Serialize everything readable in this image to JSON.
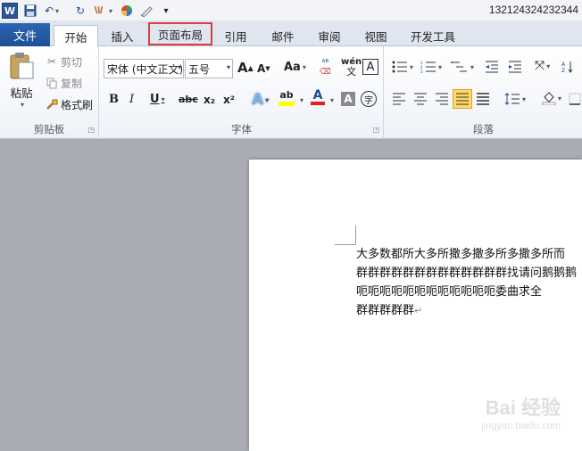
{
  "titlebar": {
    "app_icon": "W",
    "doc_title": "132124324232344",
    "icons": [
      "word-logo-icon",
      "save-icon",
      "undo-icon",
      "redo-icon",
      "format-painter-icon",
      "color-icon",
      "pen-icon",
      "customize-icon"
    ]
  },
  "tabs": {
    "file": "文件",
    "items": [
      "开始",
      "插入",
      "页面布局",
      "引用",
      "邮件",
      "审阅",
      "视图",
      "开发工具"
    ],
    "active": "开始",
    "highlighted": "页面布局"
  },
  "ribbon": {
    "clipboard": {
      "label": "剪贴板",
      "paste": "粘贴",
      "cut": "剪切",
      "copy": "复制",
      "format_painter": "格式刷"
    },
    "font": {
      "label": "字体",
      "font_name": "宋体 (中文正文)",
      "font_size": "五号",
      "grow": "A",
      "shrink": "A",
      "change_case": "Aa",
      "phonetic": "wén",
      "border_char": "A",
      "bold": "B",
      "italic": "I",
      "underline": "U",
      "strike": "abc",
      "subscript": "x₂",
      "superscript": "x²",
      "text_effect": "A",
      "highlight": "ab",
      "font_color": "A",
      "char_shading": "A",
      "enclose": "字"
    },
    "paragraph": {
      "label": "段落"
    }
  },
  "document": {
    "lines": [
      "大多数都所大多所撒多撒多所多撒多所而",
      "群群群群群群群群群群群群群找请问鹅鹅鹅",
      "呃呃呃呃呃呃呃呃呃呃呃呃委曲求全",
      "群群群群群"
    ],
    "para_mark": "↵"
  },
  "watermark": {
    "main": "Bai 经验",
    "sub": "jingyan.baidu.com"
  },
  "colors": {
    "file_tab": "#1e4f94",
    "highlight_box": "#d84040",
    "selected_align": "#ffd966",
    "workspace": "#a9acb2"
  }
}
